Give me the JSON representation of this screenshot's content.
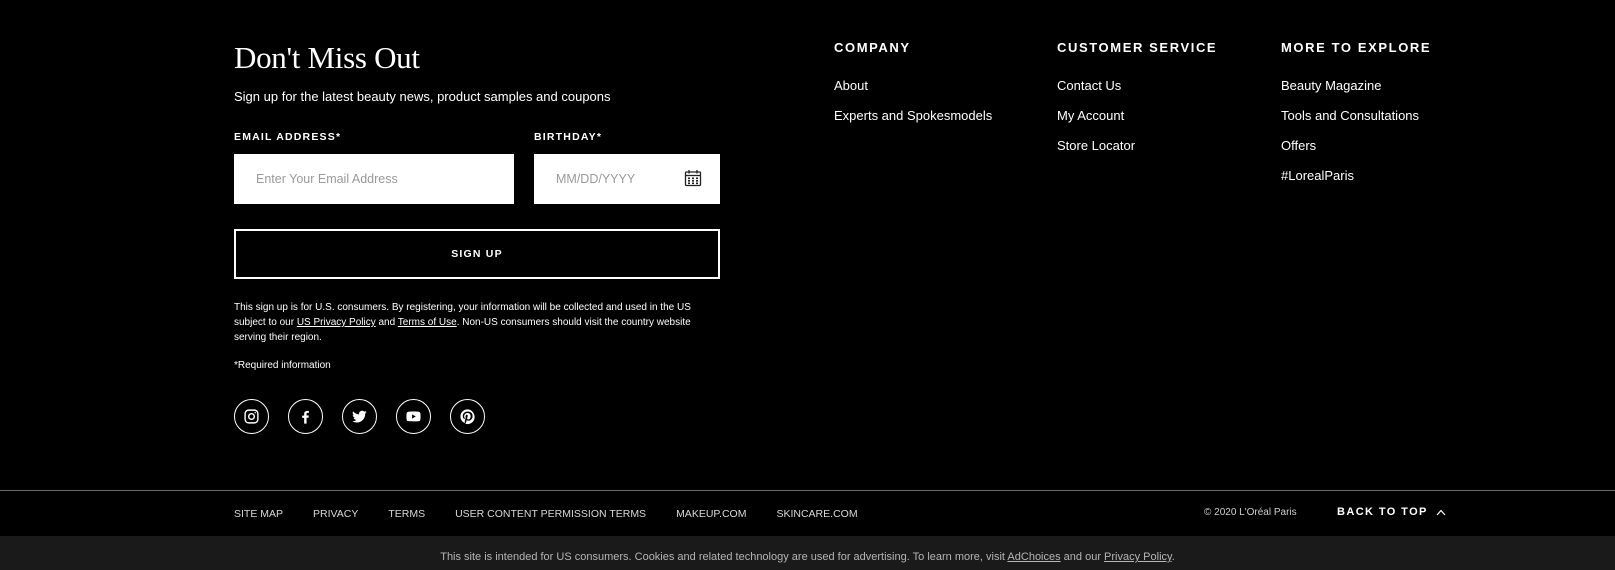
{
  "signup": {
    "title": "Don't Miss Out",
    "subtitle": "Sign up for the latest beauty news, product samples and coupons",
    "email_label": "EMAIL ADDRESS*",
    "email_placeholder": "Enter Your Email Address",
    "birthday_label": "BIRTHDAY*",
    "birthday_placeholder": "MM/DD/YYYY",
    "button_label": "SIGN UP",
    "legal_part1": "This sign up is for U.S. consumers. By registering, your information will be collected and used in the US subject to our ",
    "legal_link1": "US Privacy Policy",
    "legal_part2": " and ",
    "legal_link2": "Terms of Use",
    "legal_part3": ". Non-US consumers should visit the country website serving their region.",
    "required_note": "*Required information"
  },
  "social": [
    "instagram-icon",
    "facebook-icon",
    "twitter-icon",
    "youtube-icon",
    "pinterest-icon"
  ],
  "columns": {
    "company": {
      "heading": "COMPANY",
      "items": [
        "About",
        "Experts and Spokesmodels"
      ]
    },
    "customer_service": {
      "heading": "CUSTOMER SERVICE",
      "items": [
        "Contact Us",
        "My Account",
        "Store Locator"
      ]
    },
    "more": {
      "heading": "MORE TO EXPLORE",
      "items": [
        "Beauty Magazine",
        "Tools and Consultations",
        "Offers",
        "#LorealParis"
      ]
    }
  },
  "bottom_links": [
    "SITE MAP",
    "PRIVACY",
    "TERMS",
    "USER CONTENT PERMISSION TERMS",
    "MAKEUP.COM",
    "SKINCARE.COM"
  ],
  "copyright": "© 2020 L'Oréal Paris",
  "back_to_top": "BACK TO TOP",
  "cookie": {
    "text1": "This site is intended for US consumers. Cookies and related technology are used for advertising. To learn more, visit ",
    "link1": "AdChoices",
    "text2": " and our ",
    "link2": "Privacy Policy",
    "text3": "."
  },
  "colors": {
    "background": "#000000",
    "text": "#ffffff",
    "divider": "#6a6a6a"
  }
}
